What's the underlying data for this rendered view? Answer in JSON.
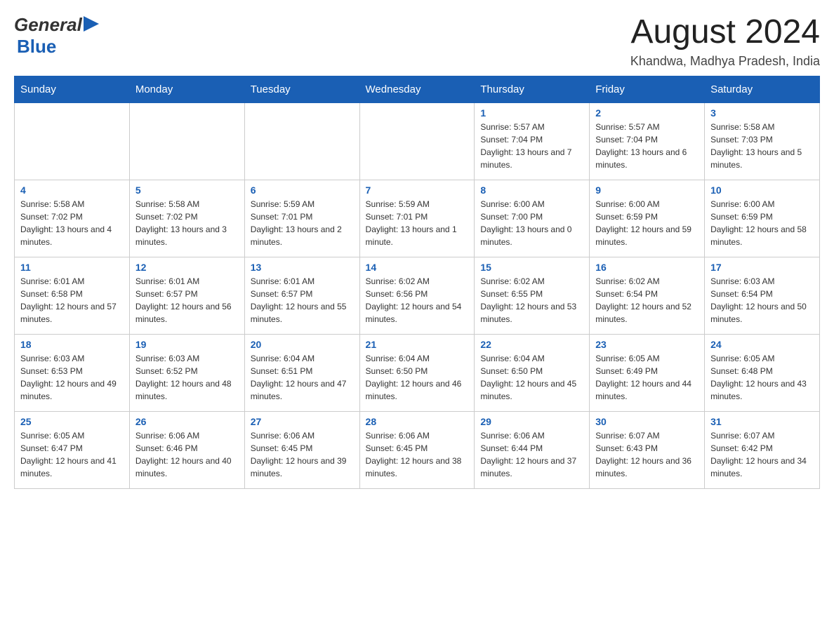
{
  "header": {
    "logo_general": "General",
    "logo_blue": "Blue",
    "title": "August 2024",
    "location": "Khandwa, Madhya Pradesh, India"
  },
  "days_of_week": [
    "Sunday",
    "Monday",
    "Tuesday",
    "Wednesday",
    "Thursday",
    "Friday",
    "Saturday"
  ],
  "weeks": [
    {
      "days": [
        {
          "number": "",
          "info": ""
        },
        {
          "number": "",
          "info": ""
        },
        {
          "number": "",
          "info": ""
        },
        {
          "number": "",
          "info": ""
        },
        {
          "number": "1",
          "info": "Sunrise: 5:57 AM\nSunset: 7:04 PM\nDaylight: 13 hours and 7 minutes."
        },
        {
          "number": "2",
          "info": "Sunrise: 5:57 AM\nSunset: 7:04 PM\nDaylight: 13 hours and 6 minutes."
        },
        {
          "number": "3",
          "info": "Sunrise: 5:58 AM\nSunset: 7:03 PM\nDaylight: 13 hours and 5 minutes."
        }
      ]
    },
    {
      "days": [
        {
          "number": "4",
          "info": "Sunrise: 5:58 AM\nSunset: 7:02 PM\nDaylight: 13 hours and 4 minutes."
        },
        {
          "number": "5",
          "info": "Sunrise: 5:58 AM\nSunset: 7:02 PM\nDaylight: 13 hours and 3 minutes."
        },
        {
          "number": "6",
          "info": "Sunrise: 5:59 AM\nSunset: 7:01 PM\nDaylight: 13 hours and 2 minutes."
        },
        {
          "number": "7",
          "info": "Sunrise: 5:59 AM\nSunset: 7:01 PM\nDaylight: 13 hours and 1 minute."
        },
        {
          "number": "8",
          "info": "Sunrise: 6:00 AM\nSunset: 7:00 PM\nDaylight: 13 hours and 0 minutes."
        },
        {
          "number": "9",
          "info": "Sunrise: 6:00 AM\nSunset: 6:59 PM\nDaylight: 12 hours and 59 minutes."
        },
        {
          "number": "10",
          "info": "Sunrise: 6:00 AM\nSunset: 6:59 PM\nDaylight: 12 hours and 58 minutes."
        }
      ]
    },
    {
      "days": [
        {
          "number": "11",
          "info": "Sunrise: 6:01 AM\nSunset: 6:58 PM\nDaylight: 12 hours and 57 minutes."
        },
        {
          "number": "12",
          "info": "Sunrise: 6:01 AM\nSunset: 6:57 PM\nDaylight: 12 hours and 56 minutes."
        },
        {
          "number": "13",
          "info": "Sunrise: 6:01 AM\nSunset: 6:57 PM\nDaylight: 12 hours and 55 minutes."
        },
        {
          "number": "14",
          "info": "Sunrise: 6:02 AM\nSunset: 6:56 PM\nDaylight: 12 hours and 54 minutes."
        },
        {
          "number": "15",
          "info": "Sunrise: 6:02 AM\nSunset: 6:55 PM\nDaylight: 12 hours and 53 minutes."
        },
        {
          "number": "16",
          "info": "Sunrise: 6:02 AM\nSunset: 6:54 PM\nDaylight: 12 hours and 52 minutes."
        },
        {
          "number": "17",
          "info": "Sunrise: 6:03 AM\nSunset: 6:54 PM\nDaylight: 12 hours and 50 minutes."
        }
      ]
    },
    {
      "days": [
        {
          "number": "18",
          "info": "Sunrise: 6:03 AM\nSunset: 6:53 PM\nDaylight: 12 hours and 49 minutes."
        },
        {
          "number": "19",
          "info": "Sunrise: 6:03 AM\nSunset: 6:52 PM\nDaylight: 12 hours and 48 minutes."
        },
        {
          "number": "20",
          "info": "Sunrise: 6:04 AM\nSunset: 6:51 PM\nDaylight: 12 hours and 47 minutes."
        },
        {
          "number": "21",
          "info": "Sunrise: 6:04 AM\nSunset: 6:50 PM\nDaylight: 12 hours and 46 minutes."
        },
        {
          "number": "22",
          "info": "Sunrise: 6:04 AM\nSunset: 6:50 PM\nDaylight: 12 hours and 45 minutes."
        },
        {
          "number": "23",
          "info": "Sunrise: 6:05 AM\nSunset: 6:49 PM\nDaylight: 12 hours and 44 minutes."
        },
        {
          "number": "24",
          "info": "Sunrise: 6:05 AM\nSunset: 6:48 PM\nDaylight: 12 hours and 43 minutes."
        }
      ]
    },
    {
      "days": [
        {
          "number": "25",
          "info": "Sunrise: 6:05 AM\nSunset: 6:47 PM\nDaylight: 12 hours and 41 minutes."
        },
        {
          "number": "26",
          "info": "Sunrise: 6:06 AM\nSunset: 6:46 PM\nDaylight: 12 hours and 40 minutes."
        },
        {
          "number": "27",
          "info": "Sunrise: 6:06 AM\nSunset: 6:45 PM\nDaylight: 12 hours and 39 minutes."
        },
        {
          "number": "28",
          "info": "Sunrise: 6:06 AM\nSunset: 6:45 PM\nDaylight: 12 hours and 38 minutes."
        },
        {
          "number": "29",
          "info": "Sunrise: 6:06 AM\nSunset: 6:44 PM\nDaylight: 12 hours and 37 minutes."
        },
        {
          "number": "30",
          "info": "Sunrise: 6:07 AM\nSunset: 6:43 PM\nDaylight: 12 hours and 36 minutes."
        },
        {
          "number": "31",
          "info": "Sunrise: 6:07 AM\nSunset: 6:42 PM\nDaylight: 12 hours and 34 minutes."
        }
      ]
    }
  ]
}
